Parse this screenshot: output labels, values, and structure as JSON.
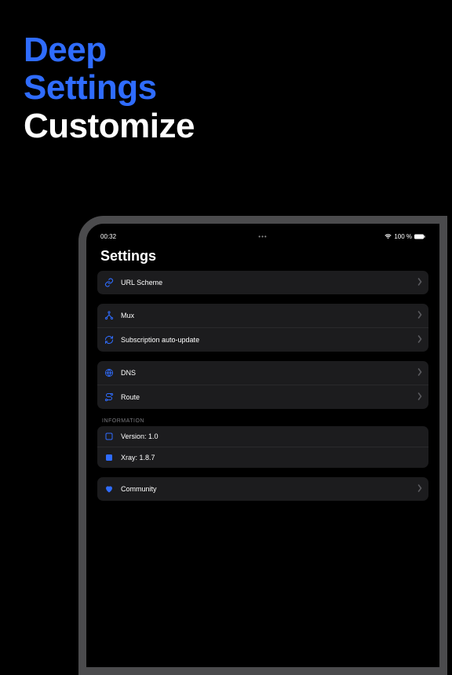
{
  "hero": {
    "line1": "Deep",
    "line2": "Settings",
    "line3": "Customize"
  },
  "device": {
    "statusBar": {
      "time": "00:32",
      "dots": "•••",
      "battery": "100 %"
    },
    "pageTitle": "Settings",
    "groups": [
      {
        "header": null,
        "rows": [
          {
            "icon": "link-icon",
            "label": "URL Scheme",
            "chevron": true,
            "color": "#2f6cff"
          }
        ]
      },
      {
        "header": null,
        "rows": [
          {
            "icon": "branch-icon",
            "label": "Mux",
            "chevron": true,
            "color": "#2f6cff"
          },
          {
            "icon": "refresh-icon",
            "label": "Subscription auto-update",
            "chevron": true,
            "color": "#2f6cff"
          }
        ]
      },
      {
        "header": null,
        "rows": [
          {
            "icon": "globe-icon",
            "label": "DNS",
            "chevron": true,
            "color": "#2f6cff"
          },
          {
            "icon": "route-icon",
            "label": "Route",
            "chevron": true,
            "color": "#2f6cff"
          }
        ]
      },
      {
        "header": "INFORMATION",
        "rows": [
          {
            "icon": "square-icon",
            "label": "Version: 1.0",
            "chevron": false,
            "color": "#2f6cff"
          },
          {
            "icon": "square-fill-icon",
            "label": "Xray: 1.8.7",
            "chevron": false,
            "color": "#2f6cff"
          }
        ]
      },
      {
        "header": null,
        "rows": [
          {
            "icon": "heart-icon",
            "label": "Community",
            "chevron": true,
            "color": "#2f6cff"
          }
        ]
      }
    ]
  }
}
